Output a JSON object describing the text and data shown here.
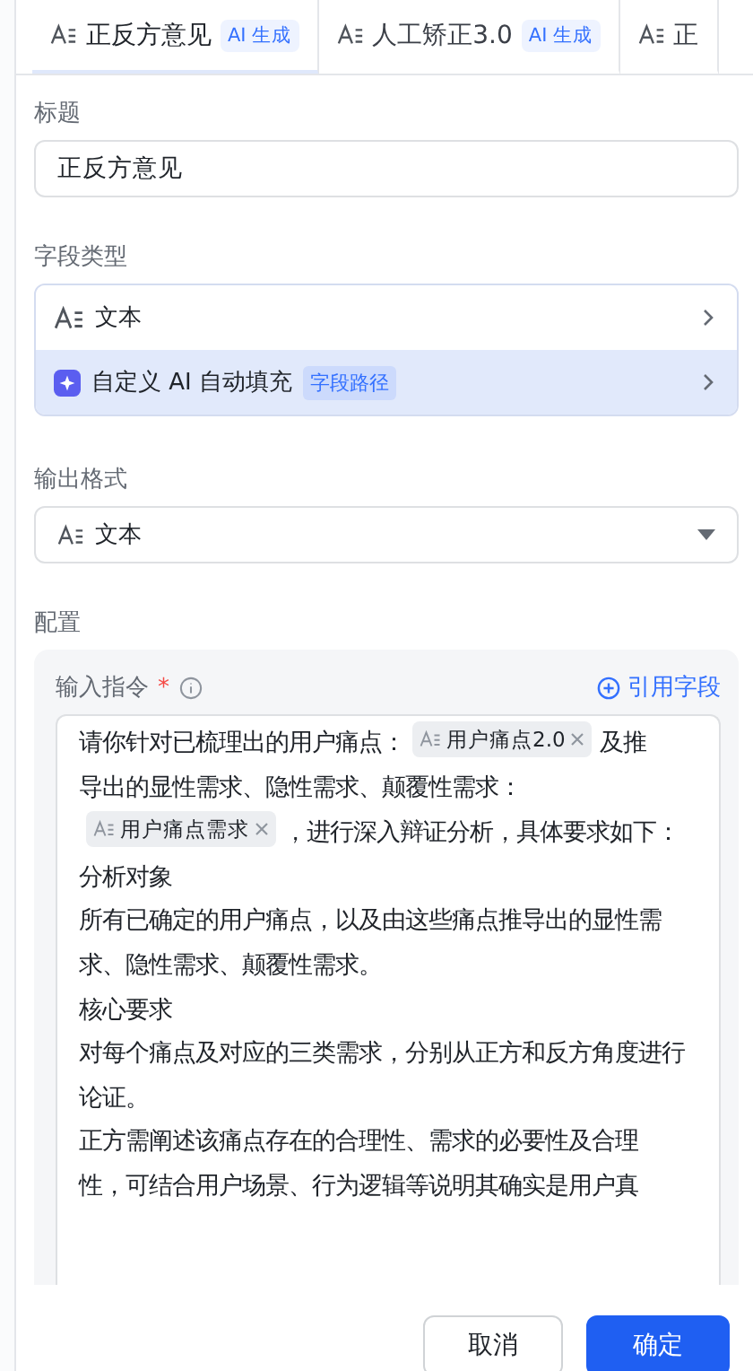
{
  "tabs": [
    {
      "label": "正反方意见",
      "badge": "AI 生成",
      "selected": true
    },
    {
      "label": "人工矫正3.0",
      "badge": "AI 生成",
      "selected": false
    },
    {
      "label": "正",
      "selected": false
    }
  ],
  "title_field": {
    "label": "标题",
    "value": "正反方意见"
  },
  "field_type": {
    "label": "字段类型",
    "type_row": {
      "label": "文本"
    },
    "ai_row": {
      "label": "自定义 AI 自动填充",
      "tag": "字段路径"
    }
  },
  "output_format": {
    "label": "输出格式",
    "value": "文本"
  },
  "config": {
    "label": "配置",
    "instruction_label": "输入指令",
    "required_mark": "*",
    "reference_link": "引用字段",
    "paragraphs": [
      {
        "segments": [
          {
            "kind": "text",
            "text": "请你针对已梳理出的用户痛点："
          },
          {
            "kind": "chip",
            "text": "用户痛点2.0"
          },
          {
            "kind": "text",
            "text": "及推"
          },
          {
            "kind": "text",
            "text": "导出的显性需求、隐性需求、颠覆性需求："
          },
          {
            "kind": "chip",
            "text": "用户痛点需求"
          },
          {
            "kind": "text",
            "text": "，进行深入辩证分析，具体要求如"
          },
          {
            "kind": "text",
            "text": "下："
          }
        ]
      },
      {
        "segments": [
          {
            "kind": "text",
            "text": "分析对象"
          }
        ]
      },
      {
        "segments": [
          {
            "kind": "text",
            "text": "所有已确定的用户痛点，以及由这些痛点推导出的显性需求、隐性需求、颠覆性需求。"
          }
        ]
      },
      {
        "segments": [
          {
            "kind": "text",
            "text": "核心要求"
          }
        ]
      },
      {
        "segments": [
          {
            "kind": "text",
            "text": "对每个痛点及对应的三类需求，分别从正方和反方角度进行论证。"
          }
        ]
      },
      {
        "segments": [
          {
            "kind": "text",
            "text": "正方需阐述该痛点存在的合理性、需求的必要性及合理"
          },
          {
            "kind": "text",
            "text": "性，可结合用户场景、行为逻辑等说明其确实是用户真"
          }
        ]
      }
    ]
  },
  "buttons": [
    {
      "label": "取消",
      "kind": "secondary"
    },
    {
      "label": "确定",
      "kind": "primary"
    }
  ]
}
